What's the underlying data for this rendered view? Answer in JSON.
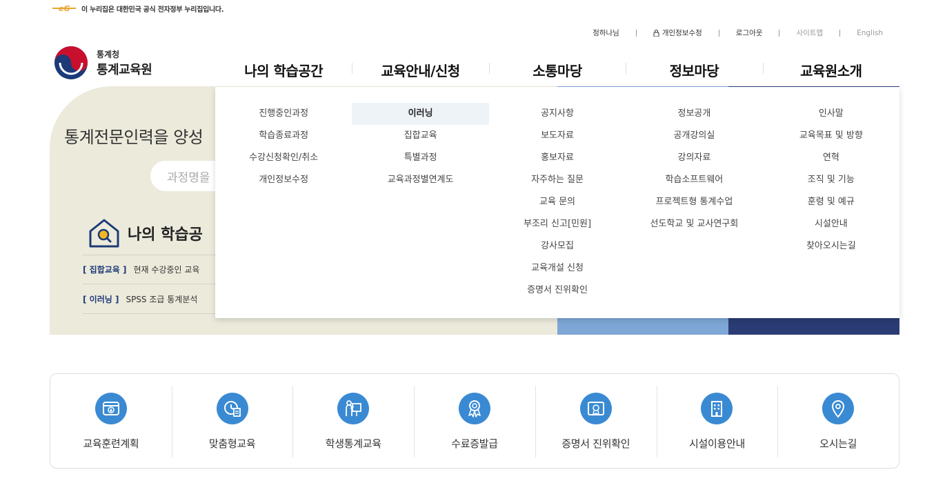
{
  "gov_banner": {
    "text": "이 누리집은 대한민국 공식 전자정부 누리집입니다."
  },
  "util_menu": {
    "sharing": "정하나님",
    "edit_info": "개인정보수정",
    "logout": "로그아웃",
    "sitemap": "사이트맵",
    "english": "English"
  },
  "logo": {
    "small": "통계청",
    "big": "통계교육원"
  },
  "gnb": [
    {
      "label": "나의 학습공간"
    },
    {
      "label": "교육안내/신청"
    },
    {
      "label": "소통마당"
    },
    {
      "label": "정보마당"
    },
    {
      "label": "교육원소개"
    }
  ],
  "mega_menu": {
    "col1": [
      "진행중인과정",
      "학습종료과정",
      "수강신청확인/취소",
      "개인정보수정"
    ],
    "col2": [
      "이러닝",
      "집합교육",
      "특별과정",
      "교육과정별연계도"
    ],
    "col3": [
      "공지사항",
      "보도자료",
      "홍보자료",
      "자주하는 질문",
      "교육 문의",
      "부조리 신고[민원]",
      "강사모집",
      "교육개설 신청",
      "증명서 진위확인"
    ],
    "col4": [
      "정보공개",
      "공개강의실",
      "강의자료",
      "학습소프트웨어",
      "프로젝트형 통계수업",
      "선도학교 및 교사연구회"
    ],
    "col5": [
      "인사말",
      "교육목표 및 방향",
      "연혁",
      "조직 및 기능",
      "훈령 및 예규",
      "시설안내",
      "찾아오시는길"
    ]
  },
  "hero": {
    "title": "통계전문인력을 양성",
    "search_placeholder": "과정명을",
    "study_title": "나의 학습공",
    "notices": [
      {
        "tag": "[ 집합교육 ]",
        "text": "현재 수강중인 교육"
      },
      {
        "tag": "[ 이러닝 ]",
        "text": "SPSS 조급 통계분석"
      }
    ]
  },
  "quick_menu": [
    {
      "label": "교육훈련계획",
      "icon": "download-card-icon"
    },
    {
      "label": "맞춤형교육",
      "icon": "clock-document-icon"
    },
    {
      "label": "학생통계교육",
      "icon": "teacher-board-icon"
    },
    {
      "label": "수료증발급",
      "icon": "award-badge-icon"
    },
    {
      "label": "증명서 진위확인",
      "icon": "certificate-icon"
    },
    {
      "label": "시설이용안내",
      "icon": "building-icon"
    },
    {
      "label": "오시는길",
      "icon": "location-pin-icon"
    }
  ],
  "colors": {
    "accent": "#3a8ad3",
    "hero_bg": "#eceadb",
    "navy": "#2b3c74",
    "sky": "#7ea7d6"
  }
}
